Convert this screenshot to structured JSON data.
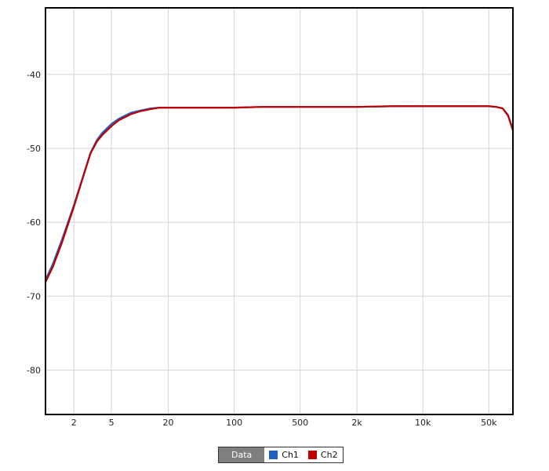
{
  "chart_data": {
    "type": "line",
    "title": "",
    "xlabel": "",
    "ylabel": "",
    "xscale": "log",
    "xlim": [
      1,
      90000
    ],
    "ylim": [
      -86,
      -31
    ],
    "grid": true,
    "legend_placement": "bottom-center",
    "x_ticks": [
      {
        "value": 2,
        "label": "2"
      },
      {
        "value": 5,
        "label": "5"
      },
      {
        "value": 20,
        "label": "20"
      },
      {
        "value": 100,
        "label": "100"
      },
      {
        "value": 500,
        "label": "500"
      },
      {
        "value": 2000,
        "label": "2k"
      },
      {
        "value": 10000,
        "label": "10k"
      },
      {
        "value": 50000,
        "label": "50k"
      }
    ],
    "y_ticks": [
      {
        "value": -40,
        "label": "-40"
      },
      {
        "value": -50,
        "label": "-50"
      },
      {
        "value": -60,
        "label": "-60"
      },
      {
        "value": -70,
        "label": "-70"
      },
      {
        "value": -80,
        "label": "-80"
      }
    ],
    "legend": {
      "title": "Data",
      "entries": [
        {
          "name": "Ch1",
          "color": "#1f5fbf"
        },
        {
          "name": "Ch2",
          "color": "#c00000"
        }
      ]
    },
    "series": [
      {
        "name": "Ch1",
        "color": "#1f5fbf",
        "x": [
          1,
          1.2,
          1.5,
          2,
          2.5,
          3,
          3.5,
          4,
          5,
          6,
          8,
          10,
          13,
          16,
          20,
          30,
          50,
          100,
          200,
          500,
          1000,
          2000,
          5000,
          10000,
          20000,
          40000,
          50000,
          60000,
          70000,
          80000,
          90000
        ],
        "y": [
          -67.8,
          -65.6,
          -62.3,
          -57.7,
          -53.8,
          -50.6,
          -48.9,
          -47.9,
          -46.7,
          -46.0,
          -45.2,
          -44.9,
          -44.6,
          -44.5,
          -44.5,
          -44.5,
          -44.5,
          -44.5,
          -44.4,
          -44.4,
          -44.4,
          -44.4,
          -44.3,
          -44.3,
          -44.3,
          -44.3,
          -44.3,
          -44.4,
          -44.6,
          -45.5,
          -47.5
        ]
      },
      {
        "name": "Ch2",
        "color": "#c00000",
        "x": [
          1,
          1.2,
          1.5,
          2,
          2.5,
          3,
          3.5,
          4,
          5,
          6,
          8,
          10,
          13,
          16,
          20,
          30,
          50,
          100,
          200,
          500,
          1000,
          2000,
          5000,
          10000,
          20000,
          40000,
          50000,
          60000,
          70000,
          80000,
          90000
        ],
        "y": [
          -68.1,
          -66.0,
          -62.7,
          -57.9,
          -53.9,
          -50.7,
          -49.1,
          -48.2,
          -47.0,
          -46.2,
          -45.4,
          -45.0,
          -44.7,
          -44.5,
          -44.5,
          -44.5,
          -44.5,
          -44.5,
          -44.4,
          -44.4,
          -44.4,
          -44.4,
          -44.3,
          -44.3,
          -44.3,
          -44.3,
          -44.3,
          -44.4,
          -44.6,
          -45.6,
          -47.6
        ]
      }
    ]
  }
}
